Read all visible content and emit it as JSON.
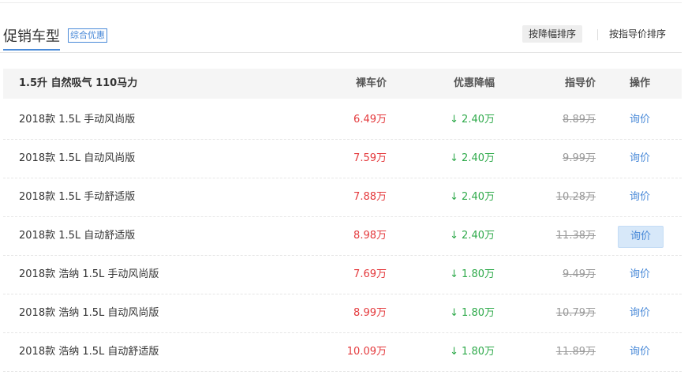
{
  "header": {
    "title": "促销车型",
    "badge": "综合优惠",
    "sort_options": [
      "按降幅排序",
      "按指导价排序"
    ]
  },
  "table": {
    "group_label": "1.5升 自然吸气 110马力",
    "columns": {
      "price": "裸车价",
      "discount": "优惠降幅",
      "guide": "指导价",
      "action": "操作"
    },
    "rows": [
      {
        "name": "2018款 1.5L 手动风尚版",
        "price": "6.49万",
        "discount": "2.40万",
        "guide": "8.89万",
        "action": "询价"
      },
      {
        "name": "2018款 1.5L 自动风尚版",
        "price": "7.59万",
        "discount": "2.40万",
        "guide": "9.99万",
        "action": "询价"
      },
      {
        "name": "2018款 1.5L 手动舒适版",
        "price": "7.88万",
        "discount": "2.40万",
        "guide": "10.28万",
        "action": "询价"
      },
      {
        "name": "2018款 1.5L 自动舒适版",
        "price": "8.98万",
        "discount": "2.40万",
        "guide": "11.38万",
        "action": "询价"
      },
      {
        "name": "2018款 浩纳 1.5L 手动风尚版",
        "price": "7.69万",
        "discount": "1.80万",
        "guide": "9.49万",
        "action": "询价"
      },
      {
        "name": "2018款 浩纳 1.5L 自动风尚版",
        "price": "8.99万",
        "discount": "1.80万",
        "guide": "10.79万",
        "action": "询价"
      },
      {
        "name": "2018款 浩纳 1.5L 自动舒适版",
        "price": "10.09万",
        "discount": "1.80万",
        "guide": "11.89万",
        "action": "询价"
      }
    ]
  },
  "colors": {
    "accent": "#4a8ad8",
    "price_red": "#e4393c",
    "discount_green": "#2faa4b",
    "muted": "#999999"
  },
  "icons": {
    "discount_arrow": "arrow-down-icon"
  }
}
